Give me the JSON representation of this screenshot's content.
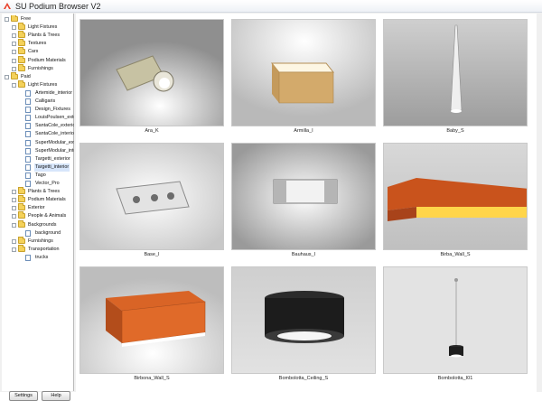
{
  "window": {
    "title": "SU Podium Browser V2"
  },
  "tree": [
    {
      "label": "Free",
      "level": 0,
      "kind": "folder",
      "expander": "-"
    },
    {
      "label": "Light Fixtures",
      "level": 1,
      "kind": "folder",
      "expander": "+"
    },
    {
      "label": "Plants & Trees",
      "level": 1,
      "kind": "folder",
      "expander": "+"
    },
    {
      "label": "Textures",
      "level": 1,
      "kind": "folder",
      "expander": "+"
    },
    {
      "label": "Cars",
      "level": 1,
      "kind": "folder",
      "expander": "+"
    },
    {
      "label": "Podium Materials",
      "level": 1,
      "kind": "folder",
      "expander": "+"
    },
    {
      "label": "Furnishings",
      "level": 1,
      "kind": "folder",
      "expander": "+"
    },
    {
      "label": "Paid",
      "level": 0,
      "kind": "folder",
      "expander": "-"
    },
    {
      "label": "Light Fixtures",
      "level": 1,
      "kind": "folder",
      "expander": "-"
    },
    {
      "label": "Artemide_interior",
      "level": 2,
      "kind": "doc",
      "expander": ""
    },
    {
      "label": "Calligaris",
      "level": 2,
      "kind": "doc",
      "expander": ""
    },
    {
      "label": "Design_Fixtures",
      "level": 2,
      "kind": "doc",
      "expander": ""
    },
    {
      "label": "LouisPoulsen_exterior",
      "level": 2,
      "kind": "doc",
      "expander": ""
    },
    {
      "label": "SantaCole_exterior",
      "level": 2,
      "kind": "doc",
      "expander": ""
    },
    {
      "label": "SantaCole_interior",
      "level": 2,
      "kind": "doc",
      "expander": ""
    },
    {
      "label": "SuperModular_exterior",
      "level": 2,
      "kind": "doc",
      "expander": ""
    },
    {
      "label": "SuperModular_interior",
      "level": 2,
      "kind": "doc",
      "expander": ""
    },
    {
      "label": "Targetti_exterior",
      "level": 2,
      "kind": "doc",
      "expander": ""
    },
    {
      "label": "Targetti_interior",
      "level": 2,
      "kind": "doc",
      "expander": "",
      "selected": true
    },
    {
      "label": "Tago",
      "level": 2,
      "kind": "doc",
      "expander": ""
    },
    {
      "label": "Vector_Pro",
      "level": 2,
      "kind": "doc",
      "expander": ""
    },
    {
      "label": "Plants & Trees",
      "level": 1,
      "kind": "folder",
      "expander": "+"
    },
    {
      "label": "Podium Materials",
      "level": 1,
      "kind": "folder",
      "expander": "+"
    },
    {
      "label": "Exterior",
      "level": 1,
      "kind": "folder",
      "expander": "+"
    },
    {
      "label": "People & Animals",
      "level": 1,
      "kind": "folder",
      "expander": "+"
    },
    {
      "label": "Backgrounds",
      "level": 1,
      "kind": "folder",
      "expander": "-"
    },
    {
      "label": "background",
      "level": 2,
      "kind": "doc",
      "expander": ""
    },
    {
      "label": "Furnishings",
      "level": 1,
      "kind": "folder",
      "expander": "+"
    },
    {
      "label": "Transportation",
      "level": 1,
      "kind": "folder",
      "expander": "-"
    },
    {
      "label": "trucks",
      "level": 2,
      "kind": "doc",
      "expander": ""
    }
  ],
  "buttons": {
    "settings": "Settings",
    "help": "Help"
  },
  "thumbnails": [
    {
      "caption": "Ara_K",
      "icon": "wall-spotlight-thumbnail"
    },
    {
      "caption": "Armilla_I",
      "icon": "box-lamp-thumbnail"
    },
    {
      "caption": "Baby_S",
      "icon": "pendant-cone-thumbnail"
    },
    {
      "caption": "Base_I",
      "icon": "wall-box-thumbnail"
    },
    {
      "caption": "Bauhaus_I",
      "icon": "wall-sconce-thumbnail"
    },
    {
      "caption": "Birba_Wall_S",
      "icon": "orange-wall-bar-thumbnail"
    },
    {
      "caption": "Birbona_Wall_S",
      "icon": "orange-wall-box-thumbnail"
    },
    {
      "caption": "Bombolotta_Ceiling_S",
      "icon": "black-drum-thumbnail"
    },
    {
      "caption": "Bombolotta_I01",
      "icon": "small-pendant-thumbnail"
    }
  ],
  "colors": {
    "selection": "#d7e6fb",
    "folder": "#f4d15a",
    "accent_orange": "#c9531c"
  }
}
